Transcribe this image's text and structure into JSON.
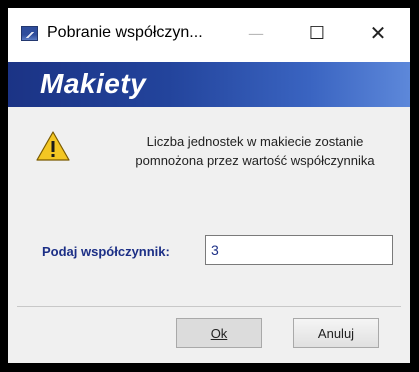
{
  "window": {
    "title": "Pobranie współczyn...",
    "minimize_glyph": "—",
    "maximize_glyph": "☐",
    "close_glyph": "✕"
  },
  "banner": {
    "title": "Makiety",
    "colors": {
      "start": "#1b3385",
      "end": "#5d88da"
    }
  },
  "message": {
    "icon": "warning-icon",
    "line1": "Liczba jednostek w makiecie zostanie",
    "line2": "pomnożona przez wartość współczynnika"
  },
  "form": {
    "label": "Podaj współczynnik:",
    "value": "3"
  },
  "buttons": {
    "ok": "Ok",
    "cancel": "Anuluj"
  }
}
